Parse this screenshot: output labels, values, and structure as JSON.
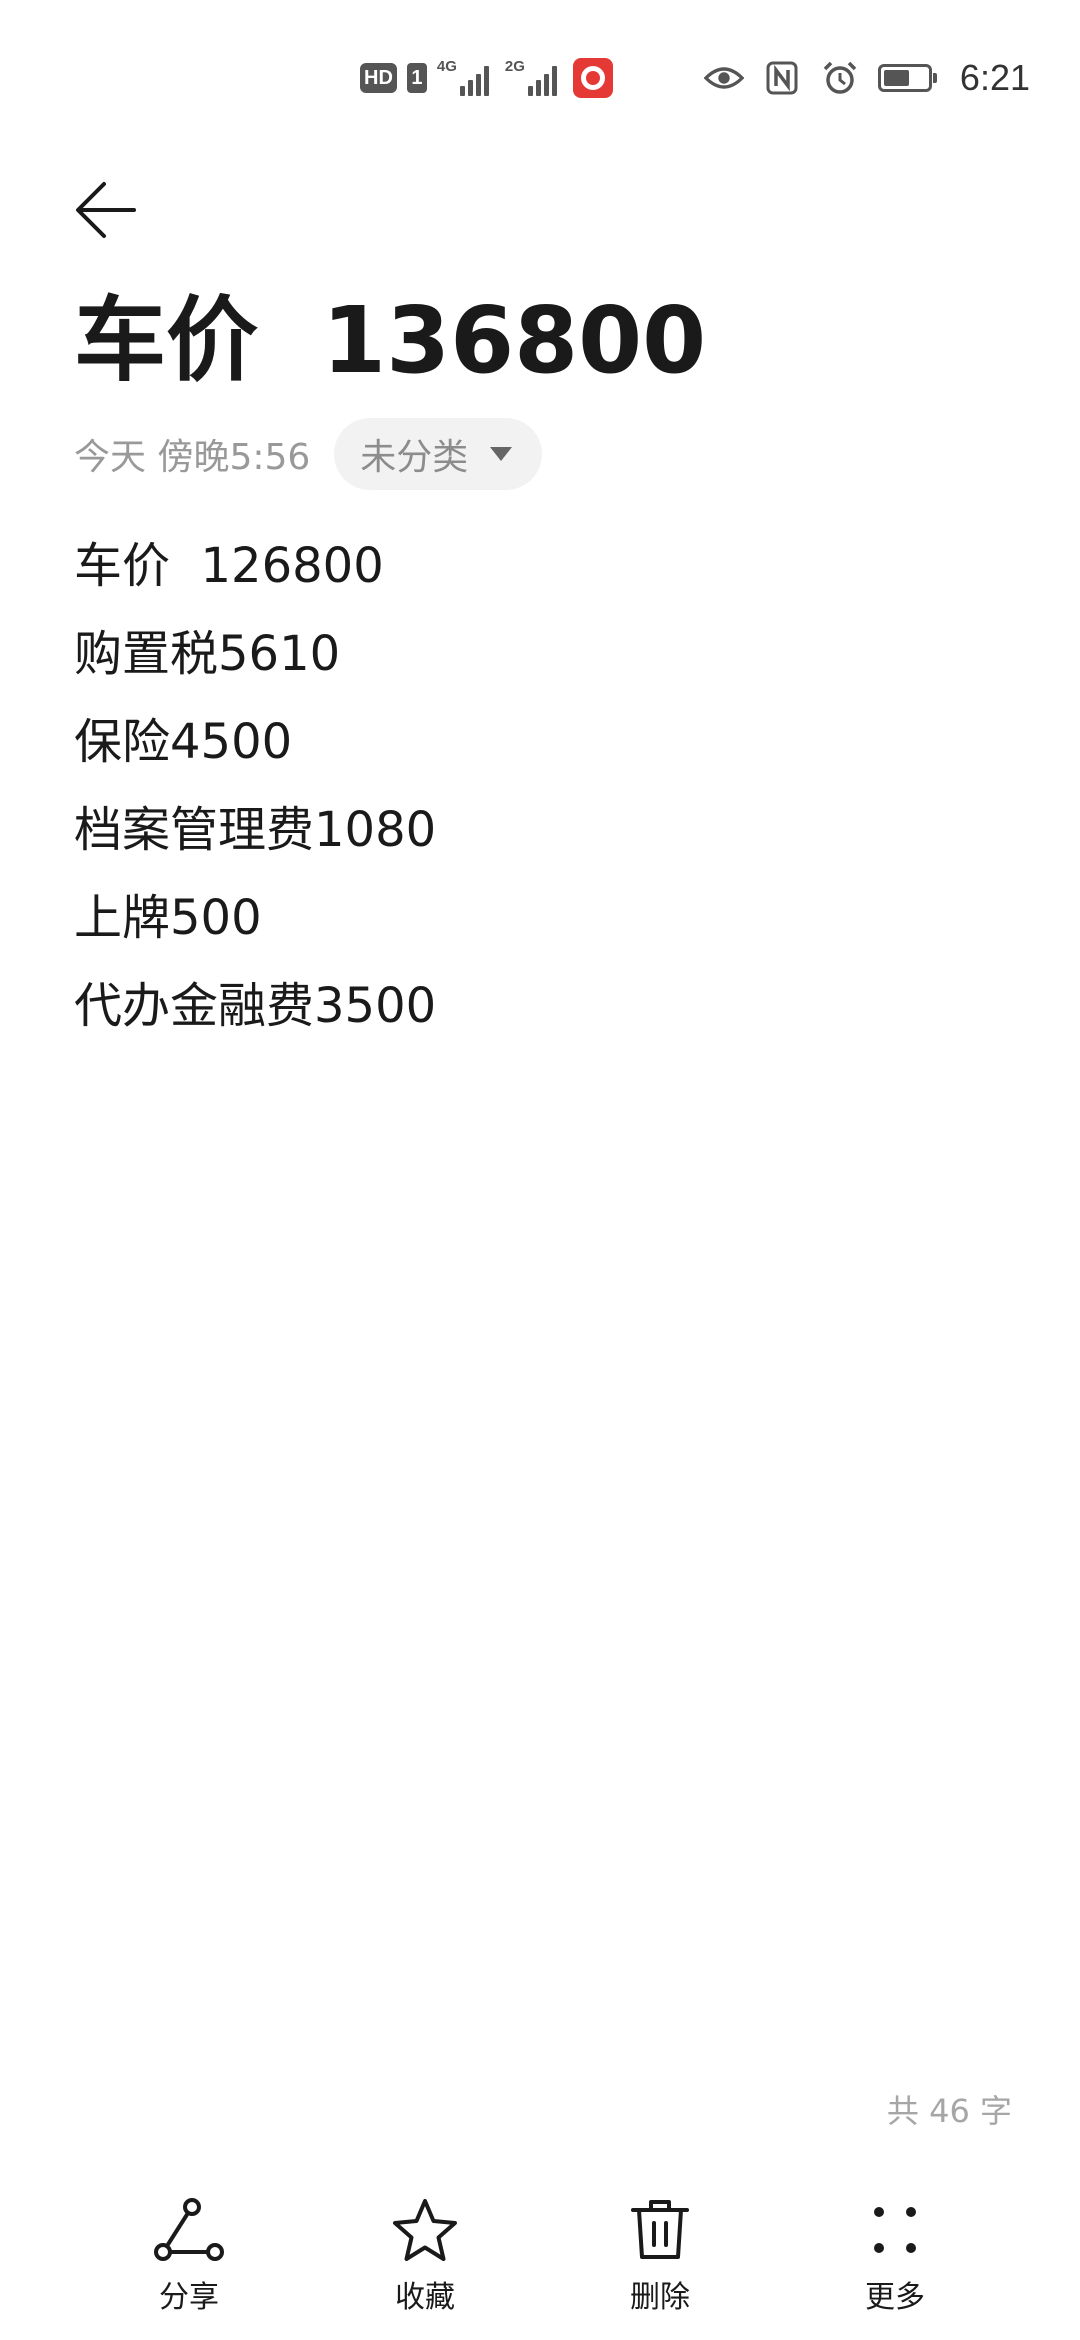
{
  "status_bar": {
    "hd": "HD",
    "sim": "1",
    "net1": "4G",
    "net2": "2G",
    "time": "6:21",
    "battery_level": 0.6,
    "icons": [
      "hd-icon",
      "sim-icon",
      "signal-4g-icon",
      "signal-2g-icon",
      "app-notification-icon",
      "eye-icon",
      "nfc-icon",
      "alarm-icon",
      "battery-icon"
    ]
  },
  "header": {
    "back_icon": "arrow-left-icon"
  },
  "note": {
    "title": "车价  136800",
    "time": "今天 傍晚5:56",
    "category": "未分类",
    "lines": [
      "车价  126800",
      "购置税5610",
      "保险4500",
      "档案管理费1080",
      "上牌500",
      "代办金融费3500"
    ],
    "char_count": "共 46 字"
  },
  "toolbar": {
    "share": "分享",
    "favorite": "收藏",
    "delete": "删除",
    "more": "更多"
  },
  "colors": {
    "text": "#1a1a1a",
    "muted": "#999999",
    "chip_bg": "#f2f2f2",
    "notif_red": "#e53935"
  }
}
